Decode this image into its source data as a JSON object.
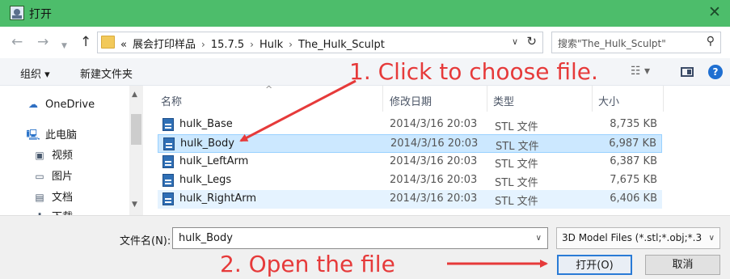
{
  "window": {
    "title": "打开",
    "close_glyph": "✕"
  },
  "address": {
    "crumbs": [
      "«",
      "展会打印样品",
      "›",
      "15.7.5",
      "›",
      "Hulk",
      "›",
      "The_Hulk_Sculpt"
    ],
    "search_placeholder": "搜索\"The_Hulk_Sculpt\""
  },
  "toolbar": {
    "organize": "组织 ▾",
    "new_folder": "新建文件夹",
    "help": "?"
  },
  "sidebar": {
    "items": [
      {
        "label": "OneDrive",
        "icon": "cloud-icon"
      },
      {
        "label": "此电脑",
        "icon": "computer-icon"
      },
      {
        "label": "视频",
        "icon": "video-icon"
      },
      {
        "label": "图片",
        "icon": "pictures-icon"
      },
      {
        "label": "文档",
        "icon": "documents-icon"
      },
      {
        "label": "下载",
        "icon": "downloads-icon"
      }
    ]
  },
  "filelist": {
    "columns": [
      "名称",
      "修改日期",
      "类型",
      "大小"
    ],
    "rows": [
      {
        "name": "hulk_Base",
        "date": "2014/3/16 20:03",
        "type": "STL 文件",
        "size": "8,735 KB",
        "state": "normal"
      },
      {
        "name": "hulk_Body",
        "date": "2014/3/16 20:03",
        "type": "STL 文件",
        "size": "6,987 KB",
        "state": "selected"
      },
      {
        "name": "hulk_LeftArm",
        "date": "2014/3/16 20:03",
        "type": "STL 文件",
        "size": "6,387 KB",
        "state": "normal"
      },
      {
        "name": "hulk_Legs",
        "date": "2014/3/16 20:03",
        "type": "STL 文件",
        "size": "7,675 KB",
        "state": "normal"
      },
      {
        "name": "hulk_RightArm",
        "date": "2014/3/16 20:03",
        "type": "STL 文件",
        "size": "6,406 KB",
        "state": "hover"
      }
    ]
  },
  "footer": {
    "filename_label": "文件名(N):",
    "filename_value": "hulk_Body",
    "filter_value": "3D Model Files (*.stl;*.obj;*.3",
    "open_label": "打开(O)",
    "cancel_label": "取消"
  },
  "annotations": {
    "step1": "1. Click to choose file.",
    "step2": "2. Open the file",
    "color": "#e63a3a"
  },
  "colors": {
    "titlebar": "#4dbd6b",
    "selection": "#cce8ff",
    "accent": "#2a7bd6"
  }
}
